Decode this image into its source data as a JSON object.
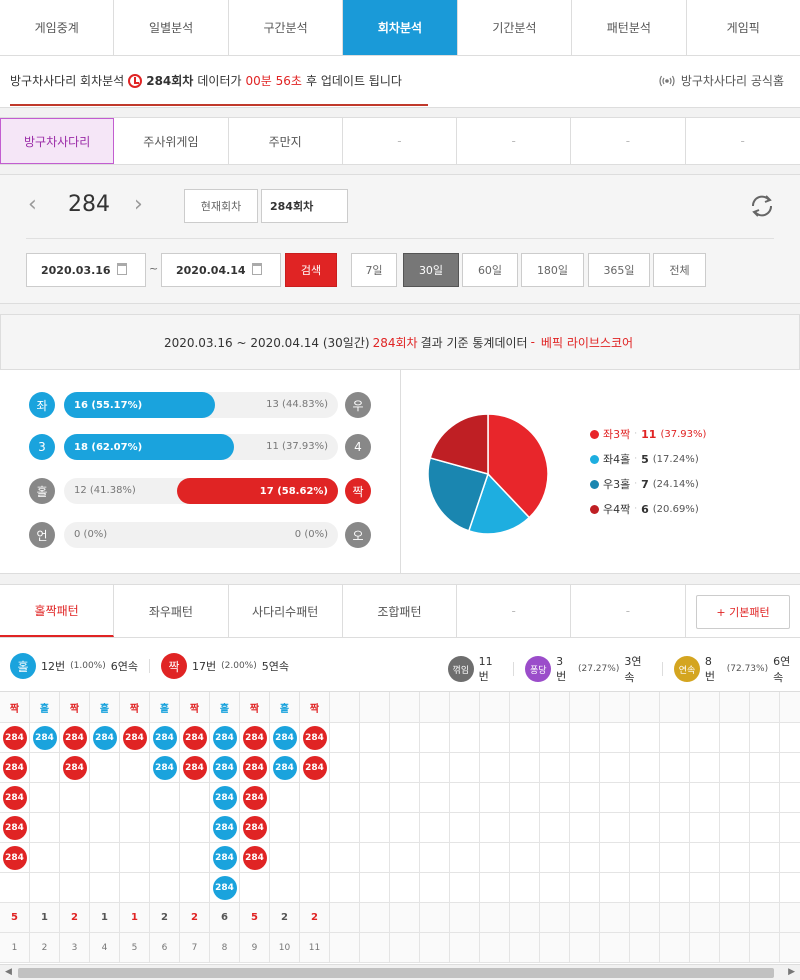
{
  "top_nav": {
    "tabs": [
      "게임중계",
      "일별분석",
      "구간분석",
      "회차분석",
      "기간분석",
      "패턴분석",
      "게임픽"
    ],
    "active_index": 3
  },
  "info_bar": {
    "prefix": "방구차사다리 회차분석",
    "round": "284회차",
    "middle": "데이터가",
    "time": "00분 56초",
    "suffix": "후 업데이트 됩니다",
    "official_link": "방구차사다리 공식홈"
  },
  "game_tabs": {
    "tabs": [
      "방구차사다리",
      "주사위게임",
      "주만지",
      "-",
      "-",
      "-",
      "-"
    ],
    "active_index": 0
  },
  "controls": {
    "round_number": "284",
    "current_round_label": "현재회차",
    "round_input_value": "284회차",
    "date_start": "2020.03.16",
    "date_tilde": "~",
    "date_end": "2020.04.14",
    "search_label": "검색",
    "periods": [
      "7일",
      "30일",
      "60일",
      "180일",
      "365일",
      "전체"
    ],
    "active_period_index": 1
  },
  "stats_header": {
    "range": "2020.03.16 ~ 2020.04.14 (30일간)",
    "round": "284회차",
    "mid": "결과 기준 통계데이터",
    "dash": "-",
    "source": "베픽 라이브스코어"
  },
  "stat_rows": [
    {
      "left_symbol": "좌",
      "left_label": "16 (55.17%)",
      "left_value": 16,
      "right_label": "13 (44.83%)",
      "right_value": 13,
      "right_symbol": "우",
      "winner": "left",
      "color": "#1aa3dd"
    },
    {
      "left_symbol": "3",
      "left_label": "18 (62.07%)",
      "left_value": 18,
      "right_label": "11 (37.93%)",
      "right_value": 11,
      "right_symbol": "4",
      "winner": "left",
      "color": "#1aa3dd"
    },
    {
      "left_symbol": "홀",
      "left_label": "12 (41.38%)",
      "left_value": 12,
      "right_label": "17 (58.62%)",
      "right_value": 17,
      "right_symbol": "짝",
      "winner": "right",
      "color": "#e02424"
    },
    {
      "left_symbol": "언",
      "left_label": "0 (0%)",
      "left_value": 0,
      "right_label": "0 (0%)",
      "right_value": 0,
      "right_symbol": "오",
      "winner": "none",
      "color": "#888888"
    }
  ],
  "chart_data": {
    "type": "pie",
    "slices": [
      {
        "label": "좌3짝",
        "value": 11,
        "display": "11",
        "pct": "(37.93%)",
        "color": "#e8262b"
      },
      {
        "label": "좌4홀",
        "value": 5,
        "display": "5",
        "pct": "(17.24%)",
        "color": "#1eaee0"
      },
      {
        "label": "우3홀",
        "value": 7,
        "display": "7",
        "pct": "(24.14%)",
        "color": "#1a86b0"
      },
      {
        "label": "우4짝",
        "value": 6,
        "display": "6",
        "pct": "(20.69%)",
        "color": "#bf1f24"
      }
    ]
  },
  "pattern_tabs": {
    "tabs": [
      "홀짝패턴",
      "좌우패턴",
      "사다리수패턴",
      "조합패턴",
      "-",
      "-"
    ],
    "active_index": 0,
    "basic_button": "+ 기본패턴"
  },
  "pattern_summary": {
    "odd": {
      "symbol": "홀",
      "count": "12번",
      "pct": "(1.00%)",
      "streak": "6연속"
    },
    "even": {
      "symbol": "짝",
      "count": "17번",
      "pct": "(2.00%)",
      "streak": "5연속"
    },
    "break": {
      "symbol": "꺾임",
      "count": "11번"
    },
    "bounce": {
      "symbol": "퐁당",
      "count": "3번",
      "pct": "(27.27%)",
      "streak": "3연속"
    },
    "consecutive": {
      "symbol": "연속",
      "count": "8번",
      "pct": "(72.73%)",
      "streak": "6연속"
    }
  },
  "pattern_grid": {
    "ball_text": "284",
    "columns": [
      {
        "head": "짝",
        "type": "even",
        "count": 5,
        "index": 1
      },
      {
        "head": "홀",
        "type": "odd",
        "count": 1,
        "index": 2
      },
      {
        "head": "짝",
        "type": "even",
        "count": 2,
        "index": 3
      },
      {
        "head": "홀",
        "type": "odd",
        "count": 1,
        "index": 4
      },
      {
        "head": "짝",
        "type": "even",
        "count": 1,
        "index": 5
      },
      {
        "head": "홀",
        "type": "odd",
        "count": 2,
        "index": 6
      },
      {
        "head": "짝",
        "type": "even",
        "count": 2,
        "index": 7
      },
      {
        "head": "홀",
        "type": "odd",
        "count": 6,
        "index": 8
      },
      {
        "head": "짝",
        "type": "even",
        "count": 5,
        "index": 9
      },
      {
        "head": "홀",
        "type": "odd",
        "count": 2,
        "index": 10
      },
      {
        "head": "짝",
        "type": "even",
        "count": 2,
        "index": 11
      }
    ],
    "total_columns": 27
  },
  "colors": {
    "blue": "#1aa3dd",
    "red": "#e02424",
    "purple": "#9b4dca",
    "gold": "#d4a520"
  }
}
